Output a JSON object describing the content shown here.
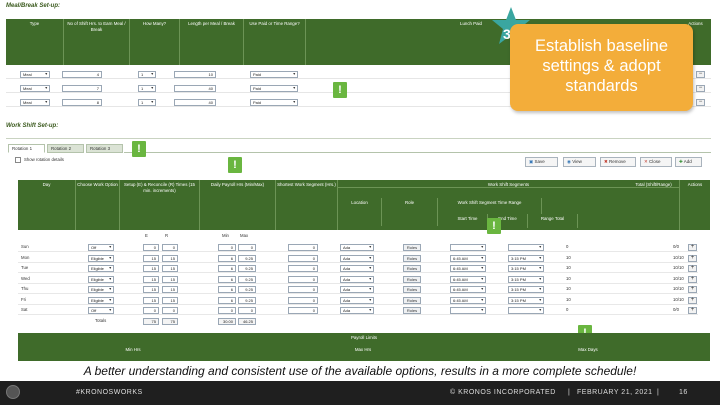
{
  "meal_section": {
    "title": "Meal/Break Set-up:",
    "headers": [
      "Type",
      "No of Shift Hrs. to Earn Meal / Break",
      "How Many?",
      "Length per Meal / Break",
      "Use Paid or Time Range?",
      "Lunch Paid",
      "Actions"
    ],
    "rows": [
      {
        "type": "Meal",
        "hrs": "4",
        "count": "1",
        "length": "10",
        "paid": "Paid"
      },
      {
        "type": "Meal",
        "hrs": "7",
        "count": "1",
        "length": "40",
        "paid": "Paid"
      },
      {
        "type": "Meal",
        "hrs": "8",
        "count": "1",
        "length": "40",
        "paid": "Paid"
      }
    ]
  },
  "callout": {
    "step": "3",
    "text_line1": "Establish baseline",
    "text_line2": "settings & adopt",
    "text_line3": "standards"
  },
  "exclamation": "!",
  "work_shift": {
    "title": "Work Shift Set-up:",
    "tabs": [
      "Rotation 1",
      "Rotation 2",
      "Rotation 3"
    ],
    "show_rotation_label": "Show rotation details",
    "toolbar": [
      "Save",
      "View",
      "Remove",
      "Close",
      "Add"
    ],
    "headers": [
      "Day",
      "Choose Work Option",
      "Setup (E) & Reconcile (R) Times (15 min. increments)",
      "Daily Payroll Hrs (Min/Max)",
      "Shortest Work Segment (Hrs.)",
      "Work Shift Segments",
      "Location",
      "Role",
      "Work Shift Segment Time Range",
      "Start Time",
      "End Time",
      "Range Total",
      "Total (Shift/Range)",
      "Actions"
    ],
    "rows": [
      {
        "day": "Sun",
        "option": "Off",
        "e": "0",
        "r": "0",
        "min": "0",
        "max": "0",
        "short": "0",
        "loc": "Ada",
        "start": "",
        "end": "",
        "range": "0",
        "total": "0/0"
      },
      {
        "day": "Mon",
        "option": "Eligible",
        "e": "15",
        "r": "15",
        "min": "6",
        "max": "9.25",
        "short": "0",
        "loc": "Ada",
        "start": "6:45 AM",
        "end": "3:15 PM",
        "range": "10",
        "total": "10/10"
      },
      {
        "day": "Tue",
        "option": "Eligible",
        "e": "15",
        "r": "15",
        "min": "6",
        "max": "9.25",
        "short": "0",
        "loc": "Ada",
        "start": "6:45 AM",
        "end": "3:15 PM",
        "range": "10",
        "total": "10/10"
      },
      {
        "day": "Wed",
        "option": "Eligible",
        "e": "15",
        "r": "15",
        "min": "6",
        "max": "9.25",
        "short": "0",
        "loc": "Ada",
        "start": "6:45 AM",
        "end": "3:15 PM",
        "range": "10",
        "total": "10/10"
      },
      {
        "day": "Thu",
        "option": "Eligible",
        "e": "15",
        "r": "15",
        "min": "6",
        "max": "9.25",
        "short": "0",
        "loc": "Ada",
        "start": "6:45 AM",
        "end": "3:15 PM",
        "range": "10",
        "total": "10/10"
      },
      {
        "day": "Fri",
        "option": "Eligible",
        "e": "15",
        "r": "15",
        "min": "6",
        "max": "9.25",
        "short": "0",
        "loc": "Ada",
        "start": "6:45 AM",
        "end": "3:15 PM",
        "range": "10",
        "total": "10/10"
      },
      {
        "day": "Sat",
        "option": "Off",
        "e": "0",
        "r": "0",
        "min": "0",
        "max": "0",
        "short": "0",
        "loc": "Ada",
        "start": "",
        "end": "",
        "range": "0",
        "total": "0/0"
      }
    ],
    "totals_label": "Totals",
    "totals": {
      "e": "75",
      "r": "75",
      "min": "30.00",
      "max": "46.25"
    },
    "role_label": "Roles"
  },
  "payroll": {
    "title": "Payroll Limits",
    "headers": [
      "Min Hrs",
      "Max Hrs",
      "Max Days"
    ]
  },
  "caption": "A better understanding and consistent use of the available options, results in a more complete schedule!",
  "footer": {
    "hashtag": "#KRONOSWORKS",
    "company": "© KRONOS INCORPORATED",
    "date": "FEBRUARY 21, 2021",
    "page": "16"
  },
  "colors": {
    "header_green": "#3f6b2a",
    "callout_orange": "#f3ad3a",
    "star_teal": "#3aa6a0",
    "alert_green": "#6ab640"
  }
}
